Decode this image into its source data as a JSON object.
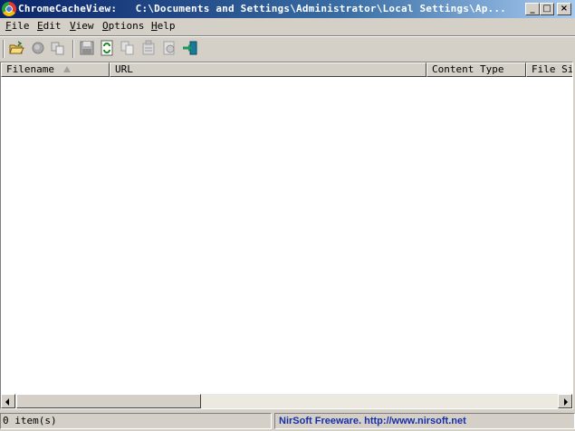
{
  "window": {
    "app_name": "ChromeCacheView:",
    "path": "C:\\Documents and Settings\\Administrator\\Local Settings\\Ap..."
  },
  "title_buttons": {
    "minimize": "_",
    "maximize": "□",
    "close": "×"
  },
  "menu": [
    {
      "accel": "F",
      "rest": "ile"
    },
    {
      "accel": "E",
      "rest": "dit"
    },
    {
      "accel": "V",
      "rest": "iew"
    },
    {
      "accel": "O",
      "rest": "ptions"
    },
    {
      "accel": "H",
      "rest": "elp"
    }
  ],
  "toolbar": {
    "icons": [
      "open-folder-icon",
      "stop-icon",
      "copy-files-icon",
      "save-icon",
      "refresh-icon",
      "copy-icon",
      "properties-icon",
      "html-report-icon",
      "exit-icon"
    ]
  },
  "columns": [
    {
      "label": "Filename"
    },
    {
      "label": "URL"
    },
    {
      "label": "Content Type"
    },
    {
      "label": "File Size"
    }
  ],
  "status": {
    "count": "0 item(s)",
    "link": "NirSoft Freeware.  http://www.nirsoft.net"
  },
  "colors": {
    "titlebar_start": "#0a246a",
    "link": "#1a2fa6",
    "face": "#d4d0c8"
  }
}
